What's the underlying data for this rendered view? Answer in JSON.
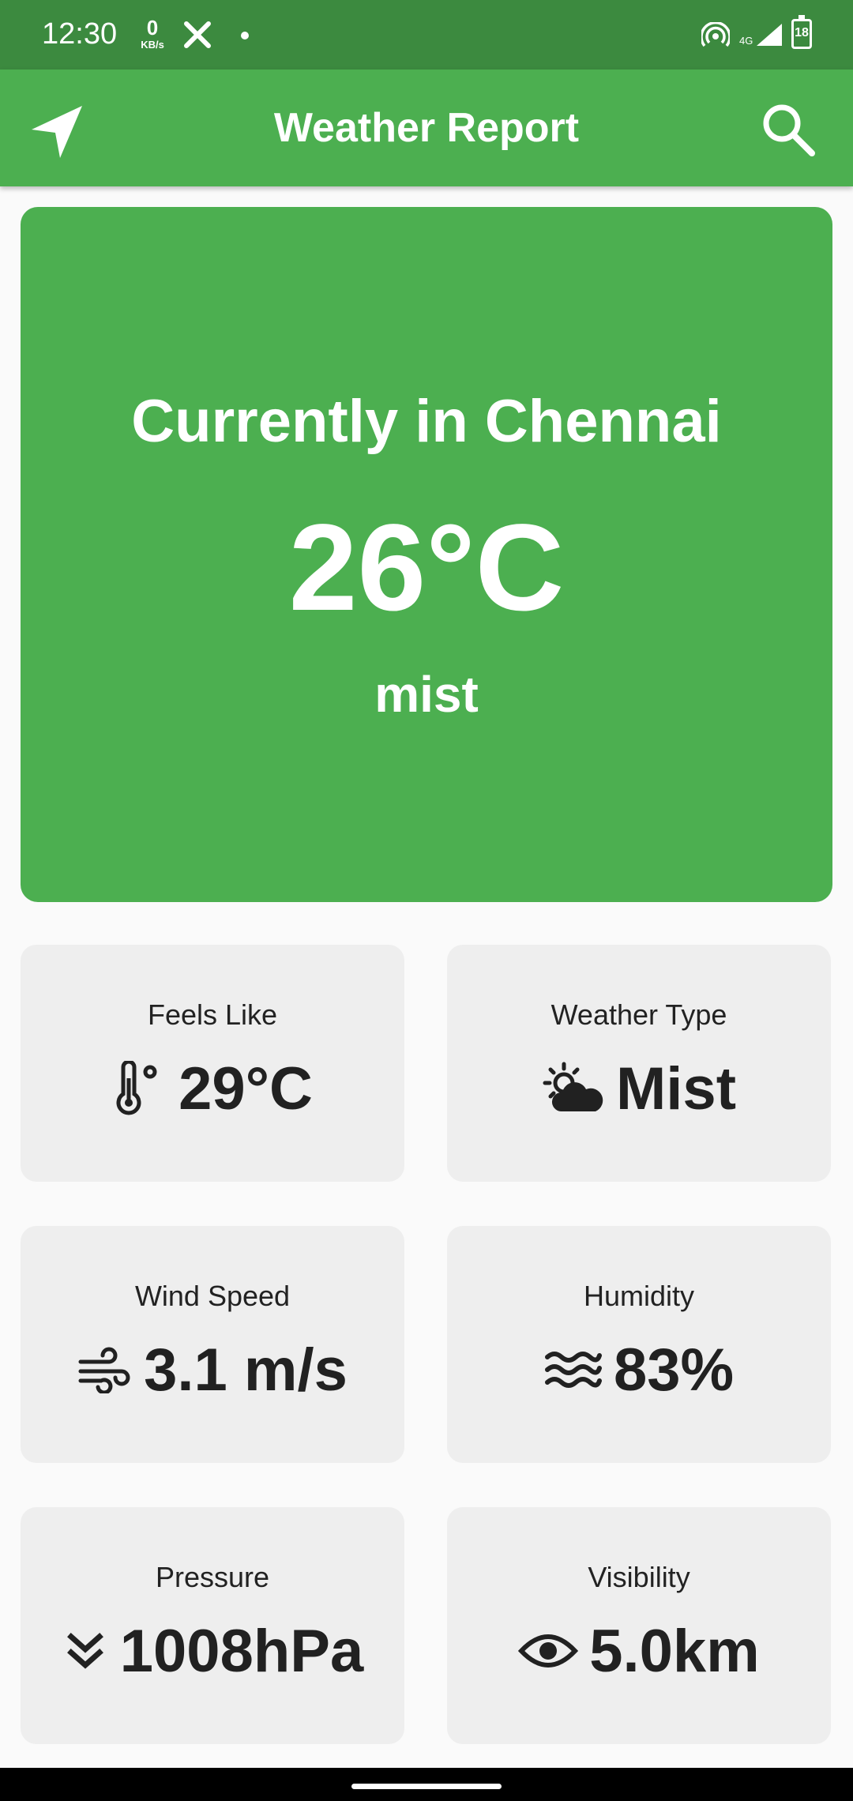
{
  "status_bar": {
    "time": "12:30",
    "net_speed_value": "0",
    "net_speed_unit": "KB/s",
    "battery": "18",
    "network_type": "4G"
  },
  "app_bar": {
    "title": "Weather Report",
    "left_icon": "navigation-arrow-icon",
    "right_icon": "search-icon"
  },
  "current": {
    "location_text": "Currently in Chennai",
    "temperature": "26°C",
    "description": "mist"
  },
  "details": [
    {
      "label": "Feels Like",
      "value": "29°C",
      "icon": "thermometer-icon"
    },
    {
      "label": "Weather Type",
      "value": "Mist",
      "icon": "partly-cloudy-icon"
    },
    {
      "label": "Wind Speed",
      "value": "3.1 m/s",
      "icon": "wind-icon"
    },
    {
      "label": "Humidity",
      "value": "83%",
      "icon": "water-waves-icon"
    },
    {
      "label": "Pressure",
      "value": "1008hPa",
      "icon": "double-chevron-down-icon"
    },
    {
      "label": "Visibility",
      "value": "5.0km",
      "icon": "eye-icon"
    }
  ],
  "colors": {
    "primary": "#4caf50",
    "status_bar": "#3c8a3f",
    "card_background": "#eeeeee",
    "page_background": "#fafafa"
  }
}
